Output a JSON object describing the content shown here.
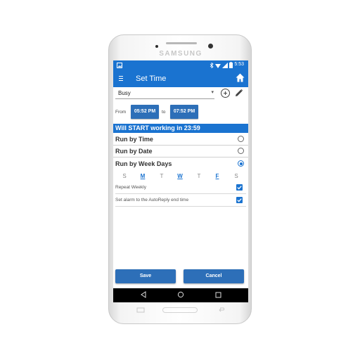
{
  "device": {
    "brand": "SAMSUNG"
  },
  "status_bar": {
    "time": "5:53"
  },
  "app_bar": {
    "title": "Set Time"
  },
  "profile": {
    "selected": "Busy"
  },
  "time_range": {
    "from_label": "From",
    "from_value": "05:52 PM",
    "to_label": "to",
    "to_value": "07:52 PM"
  },
  "banner": {
    "text": "Will START working in 23:59"
  },
  "options": [
    {
      "label": "Run by Time",
      "selected": false
    },
    {
      "label": "Run by Date",
      "selected": false
    },
    {
      "label": "Run by Week Days",
      "selected": true
    }
  ],
  "week_days": [
    {
      "label": "S",
      "selected": false
    },
    {
      "label": "M",
      "selected": true
    },
    {
      "label": "T",
      "selected": false
    },
    {
      "label": "W",
      "selected": true
    },
    {
      "label": "T",
      "selected": false
    },
    {
      "label": "F",
      "selected": true
    },
    {
      "label": "S",
      "selected": false
    }
  ],
  "repeat_weekly": {
    "label": "Repeat Weekly",
    "checked": true
  },
  "set_alarm": {
    "label": "Set alarm to the AutoReply end time",
    "checked": true
  },
  "buttons": {
    "save": "Save",
    "cancel": "Cancel"
  },
  "colors": {
    "primary": "#1a73d0",
    "button": "#2d6fb8"
  }
}
